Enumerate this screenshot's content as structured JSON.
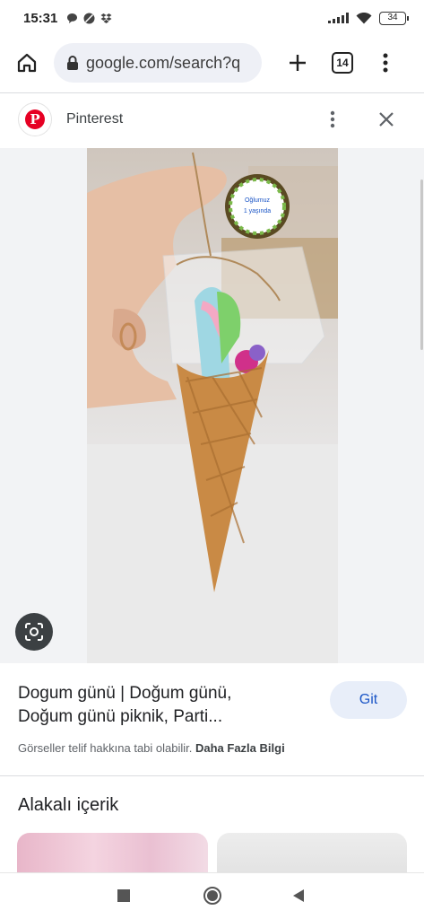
{
  "status_bar": {
    "time": "15:31",
    "battery": "34",
    "icons": [
      "chat-bubble-icon",
      "no-disturb-icon",
      "dropbox-icon",
      "signal-icon",
      "wifi-icon",
      "battery-icon"
    ]
  },
  "browser": {
    "url": "google.com/search?q",
    "tab_count": "14",
    "icons": [
      "home-icon",
      "lock-icon",
      "new-tab-icon",
      "overflow-menu-icon"
    ]
  },
  "source": {
    "name": "Pinterest",
    "icons": [
      "pinterest-logo",
      "more-vert-icon",
      "close-icon"
    ]
  },
  "result": {
    "title_line1": "Dogum günü | Doğum günü,",
    "title_line2": "Doğum günü piknik, Parti...",
    "visit_label": "Git",
    "copyright_text": "Görseller telif hakkına tabi olabilir. ",
    "more_info": "Daha Fazla Bilgi"
  },
  "photo": {
    "sticker_line1": "Oğlumuz",
    "sticker_line2": "1 yaşında"
  },
  "related": {
    "title": "Alakalı içerik"
  },
  "colors": {
    "accent": "#1a55c6",
    "button_bg": "#e8eef9",
    "pinterest_red": "#e60023",
    "cone": "#c98a45"
  }
}
